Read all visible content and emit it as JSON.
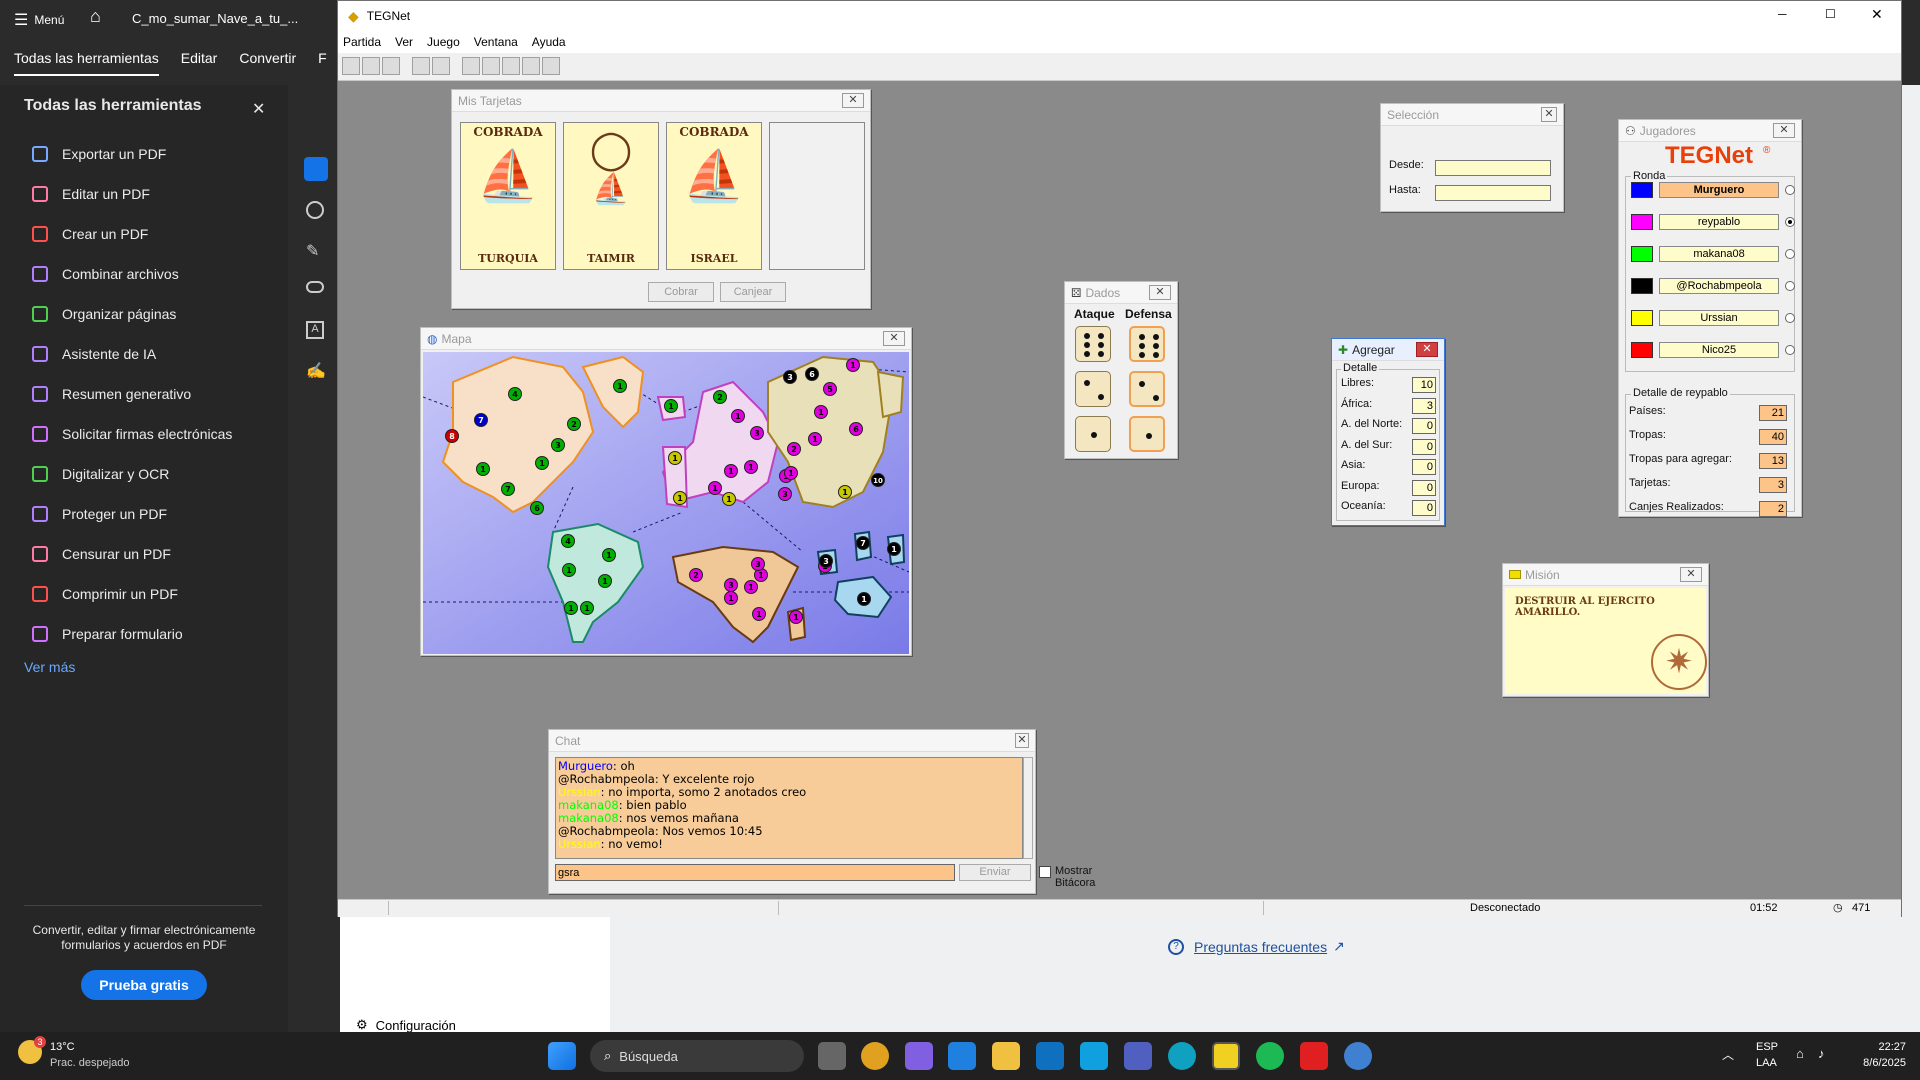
{
  "acrobat": {
    "menu_label": "Menú",
    "doc_tab": "C_mo_sumar_Nave_a_tu_...",
    "tabs": [
      "Todas las herramientas",
      "Editar",
      "Convertir",
      "F"
    ],
    "panel_title": "Todas las herramientas",
    "tools": [
      "Exportar un PDF",
      "Editar un PDF",
      "Crear un PDF",
      "Combinar archivos",
      "Organizar páginas",
      "Asistente de IA",
      "Resumen generativo",
      "Solicitar firmas electrónicas",
      "Digitalizar y OCR",
      "Proteger un PDF",
      "Censurar un PDF",
      "Comprimir un PDF",
      "Preparar formulario"
    ],
    "see_more": "Ver más",
    "promo_text": "Convertir, editar y firmar electrónicamente formularios y acuerdos en PDF",
    "trial_button": "Prueba gratis",
    "faq_link": "Preguntas frecuentes",
    "settings": "Configuración"
  },
  "teg": {
    "window_title": "TEGNet",
    "menu": [
      "Partida",
      "Ver",
      "Juego",
      "Ventana",
      "Ayuda"
    ],
    "cards_window": {
      "title": "Mis Tarjetas",
      "cards": [
        {
          "status": "COBRADA",
          "country": "TURQUIA"
        },
        {
          "status": "",
          "country": "TAIMIR"
        },
        {
          "status": "COBRADA",
          "country": "ISRAEL"
        }
      ],
      "collect_button": "Cobrar",
      "exchange_button": "Canjear"
    },
    "selection_window": {
      "title": "Selección",
      "from_label": "Desde:",
      "to_label": "Hasta:"
    },
    "dice_window": {
      "title": "Dados",
      "attack_label": "Ataque",
      "defense_label": "Defensa",
      "attack": [
        6,
        2,
        1
      ],
      "defense": [
        6,
        2,
        1
      ]
    },
    "add_window": {
      "title": "Agregar",
      "group": "Detalle",
      "rows": [
        {
          "label": "Libres:",
          "value": "10"
        },
        {
          "label": "África:",
          "value": "3"
        },
        {
          "label": "A. del Norte:",
          "value": "0"
        },
        {
          "label": "A. del Sur:",
          "value": "0"
        },
        {
          "label": "Asia:",
          "value": "0"
        },
        {
          "label": "Europa:",
          "value": "0"
        },
        {
          "label": "Oceanía:",
          "value": "0"
        }
      ]
    },
    "players_window": {
      "title": "Jugadores",
      "logo": "TEGNet",
      "round_label": "Ronda",
      "players": [
        {
          "name": "Murguero",
          "color": "#0000ff",
          "active": false,
          "highlight": true
        },
        {
          "name": "reypablo",
          "color": "#ff00ff",
          "active": true,
          "highlight": false
        },
        {
          "name": "makana08",
          "color": "#00ff00",
          "active": false,
          "highlight": false
        },
        {
          "name": "@Rochabmpeola",
          "color": "#000000",
          "active": false,
          "highlight": false
        },
        {
          "name": "Urssian",
          "color": "#ffff00",
          "active": false,
          "highlight": false
        },
        {
          "name": "Nico25",
          "color": "#ff0000",
          "active": false,
          "highlight": false
        }
      ],
      "detail_title": "Detalle de reypablo",
      "details": [
        {
          "label": "Países:",
          "value": "21"
        },
        {
          "label": "Tropas:",
          "value": "40"
        },
        {
          "label": "Tropas para agregar:",
          "value": "13"
        },
        {
          "label": "Tarjetas:",
          "value": "3"
        },
        {
          "label": "Canjes Realizados:",
          "value": "2"
        }
      ]
    },
    "map_window": {
      "title": "Mapa"
    },
    "mission_window": {
      "title": "Misión",
      "text": "DESTRUIR AL EJERCITO AMARILLO."
    },
    "chat_window": {
      "title": "Chat",
      "lines": [
        {
          "name": "Murguero",
          "color": "#0000ff",
          "text": ": oh"
        },
        {
          "name": "@Rochabmpeola",
          "color": "#000000",
          "text": ": Y excelente rojo"
        },
        {
          "name": "Urssian",
          "color": "#ffff00",
          "text": ": no importa, somo 2 anotados creo"
        },
        {
          "name": "makana08",
          "color": "#00ff00",
          "text": ": bien pablo"
        },
        {
          "name": "makana08",
          "color": "#00ff00",
          "text": ": nos vemos mañana"
        },
        {
          "name": "@Rochabmpeola",
          "color": "#000000",
          "text": ": Nos vemos 10:45"
        },
        {
          "name": "Urssian",
          "color": "#ffff00",
          "text": ": no vemo!"
        }
      ],
      "input_value": "gsra",
      "send_button": "Enviar",
      "log_checkbox": "Mostrar Bitácora"
    },
    "status": {
      "connection": "Desconectado",
      "time": "01:52",
      "count": "471"
    }
  },
  "map_armies": [
    {
      "c": "#00b000",
      "n": "4"
    },
    {
      "c": "#0000cc",
      "n": "7"
    },
    {
      "c": "#cc0000",
      "n": "8"
    },
    {
      "c": "#00b000",
      "n": "2"
    },
    {
      "c": "#00b000",
      "n": "3"
    },
    {
      "c": "#00b000",
      "n": "1"
    },
    {
      "c": "#00b000",
      "n": "1"
    },
    {
      "c": "#00b000",
      "n": "7"
    },
    {
      "c": "#00b000",
      "n": "6"
    },
    {
      "c": "#00b000",
      "n": "1"
    },
    {
      "c": "#00b000",
      "n": "1"
    },
    {
      "c": "#00b000",
      "n": "4"
    },
    {
      "c": "#00b000",
      "n": "1"
    },
    {
      "c": "#00b000",
      "n": "1"
    },
    {
      "c": "#00b000",
      "n": "1"
    },
    {
      "c": "#00b000",
      "n": "1"
    },
    {
      "c": "#00b000",
      "n": "1"
    },
    {
      "c": "#00b000",
      "n": "2"
    },
    {
      "c": "#e000e0",
      "n": "1"
    },
    {
      "c": "#c8c800",
      "n": "1"
    },
    {
      "c": "#e000e0",
      "n": "3"
    },
    {
      "c": "#e000e0",
      "n": "1"
    },
    {
      "c": "#e000e0",
      "n": "1"
    },
    {
      "c": "#e000e0",
      "n": "1"
    },
    {
      "c": "#c8c800",
      "n": "1"
    },
    {
      "c": "#c8c800",
      "n": "1"
    },
    {
      "c": "#e000e0",
      "n": "1"
    },
    {
      "c": "#e000e0",
      "n": "3"
    },
    {
      "c": "#e000e0",
      "n": "1"
    },
    {
      "c": "#000000",
      "n": "3"
    },
    {
      "c": "#000000",
      "n": "6"
    },
    {
      "c": "#e000e0",
      "n": "1"
    },
    {
      "c": "#e000e0",
      "n": "5"
    },
    {
      "c": "#e000e0",
      "n": "1"
    },
    {
      "c": "#e000e0",
      "n": "2"
    },
    {
      "c": "#e000e0",
      "n": "1"
    },
    {
      "c": "#e000e0",
      "n": "1"
    },
    {
      "c": "#e000e0",
      "n": "6"
    },
    {
      "c": "#e000e0",
      "n": "3"
    },
    {
      "c": "#e000e0",
      "n": "1"
    },
    {
      "c": "#000000",
      "n": "10"
    },
    {
      "c": "#c8c800",
      "n": "1"
    },
    {
      "c": "#e000e0",
      "n": "2"
    },
    {
      "c": "#e000e0",
      "n": "3"
    },
    {
      "c": "#e000e0",
      "n": "1"
    },
    {
      "c": "#e000e0",
      "n": "1"
    },
    {
      "c": "#e000e0",
      "n": "1"
    },
    {
      "c": "#e000e0",
      "n": "1"
    },
    {
      "c": "#000000",
      "n": "3"
    },
    {
      "c": "#000000",
      "n": "7"
    },
    {
      "c": "#000000",
      "n": "1"
    },
    {
      "c": "#000000",
      "n": "1"
    }
  ],
  "taskbar": {
    "weather_temp": "13°C",
    "weather_text": "Prac. despejado",
    "weather_badge": "3",
    "search_placeholder": "Búsqueda",
    "lang1": "ESP",
    "lang2": "LAA",
    "time": "22:27",
    "date": "8/6/2025"
  }
}
